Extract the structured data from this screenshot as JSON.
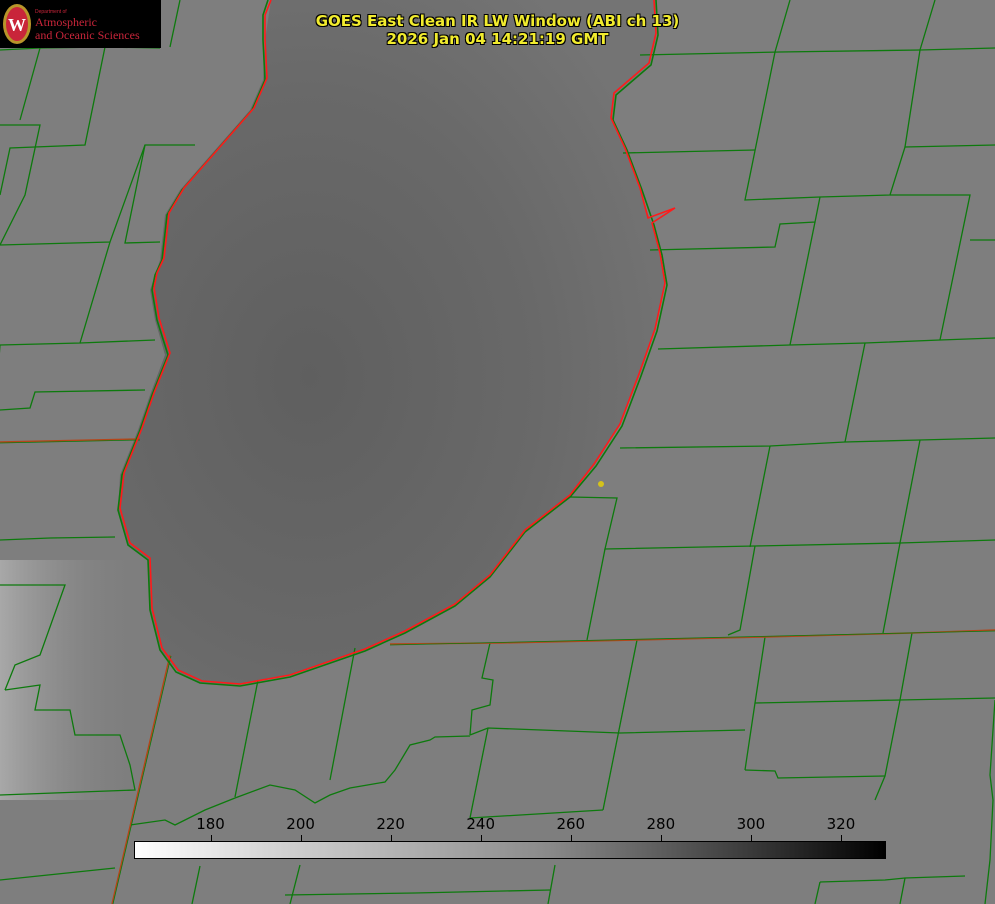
{
  "logo": {
    "dept": "Department of",
    "line1": "Atmospheric",
    "line2": "and Oceanic Sciences",
    "seal_letter": "W"
  },
  "title": {
    "line1": "GOES East Clean IR LW Window (ABI ch 13)",
    "line2": "2026 Jan 04 14:21:19 GMT"
  },
  "colorbar": {
    "ticks": [
      "180",
      "200",
      "220",
      "240",
      "260",
      "280",
      "300",
      "320"
    ],
    "range_min": 163,
    "range_max": 330,
    "gradient": "white-to-black"
  },
  "colors": {
    "title_text": "#f2ec2e",
    "shoreline": "#ff1a1a",
    "county_lines": "#0d7a0d",
    "state_line": "#b5451a",
    "lake_fill": "#6a6a6a",
    "land_fill": "#7e7e7e",
    "city_dot": "#d4c21a"
  }
}
